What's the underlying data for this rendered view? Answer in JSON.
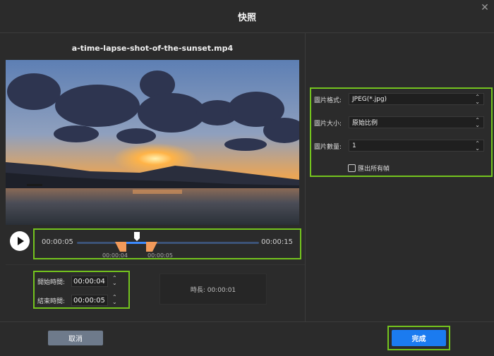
{
  "dialog": {
    "title": "快照",
    "close_glyph": "✕"
  },
  "video": {
    "filename": "a-time-lapse-shot-of-the-sunset.mp4"
  },
  "timeline": {
    "start_time": "00:00:05",
    "end_time": "00:00:15",
    "handle_left_label": "00:00:04",
    "handle_right_label": "00:00:05"
  },
  "times": {
    "start_label": "開始時間:",
    "start_value": "00:00:04",
    "end_label": "結束時間:",
    "end_value": "00:00:05",
    "spin_up": "⌃",
    "spin_down": "⌄"
  },
  "duration": {
    "text": "時長:  00:00:01"
  },
  "settings": {
    "format_label": "圖片格式:",
    "format_value": "JPEG(*.jpg)",
    "size_label": "圖片大小:",
    "size_value": "原始比例",
    "count_label": "圖片數量:",
    "count_value": "1",
    "export_all_label": "匯出所有幀",
    "export_all_checked": false
  },
  "buttons": {
    "cancel": "取消",
    "done": "完成"
  },
  "colors": {
    "highlight_outline": "#74c41e",
    "primary_button": "#1b7bf0",
    "secondary_button": "#6e7a8b",
    "handle": "#f29a5a",
    "range": "#3d8bff"
  }
}
